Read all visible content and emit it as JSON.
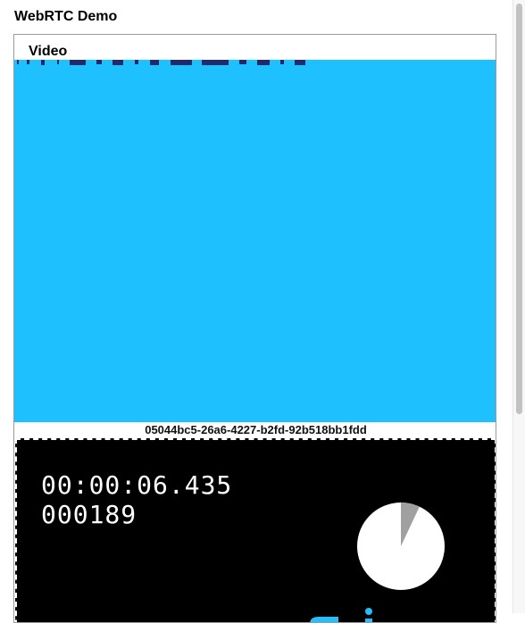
{
  "page": {
    "title": "WebRTC Demo"
  },
  "video_panel": {
    "title": "Video",
    "stream_id": "05044bc5-26a6-4227-b2fd-92b518bb1fdd",
    "video_color": "#1fc0fe",
    "canvas": {
      "timecode": "00:00:06.435",
      "frame_count": "000189",
      "pie_progress": 0.07,
      "pie_fill_color": "#ffffff",
      "pie_progress_color": "#a0a0a0"
    }
  }
}
